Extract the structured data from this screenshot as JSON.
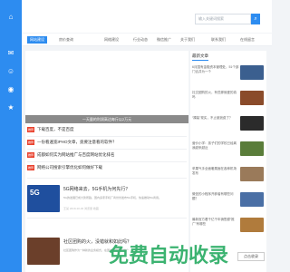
{
  "search": {
    "placeholder": "输入关键词搜索"
  },
  "nav": {
    "items": [
      "网站建设",
      "房价查询",
      "网络建设",
      "行业动态",
      "微信推广",
      "关于我们",
      "联系我们",
      "在线留言"
    ],
    "active_index": 0
  },
  "banner": {
    "caption": "一天量的利润高达每斤以2万元"
  },
  "news_list": [
    {
      "tag": "推荐",
      "title": "下载百度，不是百度"
    },
    {
      "tag": "推荐",
      "title": "一份看遍宽IPHO文章，竟要注意看的软件？"
    },
    {
      "tag": "推荐",
      "title": "成都如何实为网站推广与百度网站优化排名"
    },
    {
      "tag": "推荐",
      "title": "网络公司搜索引擎优化如何做好下载"
    }
  ],
  "articles": [
    {
      "title": "5G网络来去，5G手机为何先行？",
      "desc": "5G的发展已成大势所趋，国内多家手机厂商纷纷发布5G手机，快速推动5G商用。",
      "meta": "王某  2019-10-30  浏览量  收藏",
      "thumb_label": "5G"
    },
    {
      "title": "社区团购的火，没错就和如此吗？",
      "desc": "社区团购作为一种新的业务模式，在国内得到迅速推广",
      "meta": "王某  2019-10-29",
      "thumb_label": ""
    }
  ],
  "right": {
    "heading": "最新文章",
    "items": [
      "6月国有金融资本管理处，51个部门合并为一个",
      "社交团购的火，有些那就爱的真吗",
      "“裸装”现实，不止被浪费了？",
      "营价小学：孩子们的学校已经离我越来越近",
      "苹果气手全面奢展面在各种机场发布",
      "微信的小程序开辟者有哪些问题？",
      "最新官方看千亿千年销售额“推广”有哪些"
    ]
  },
  "watermark": {
    "text": "免费自动收录",
    "badge": "点击收录"
  },
  "colors": {
    "accent": "#2d8cf0",
    "tag": "#e9432f"
  },
  "icons": [
    "home-icon",
    "chat-icon",
    "wechat-icon",
    "weibo-icon",
    "star-icon",
    "search-icon"
  ]
}
